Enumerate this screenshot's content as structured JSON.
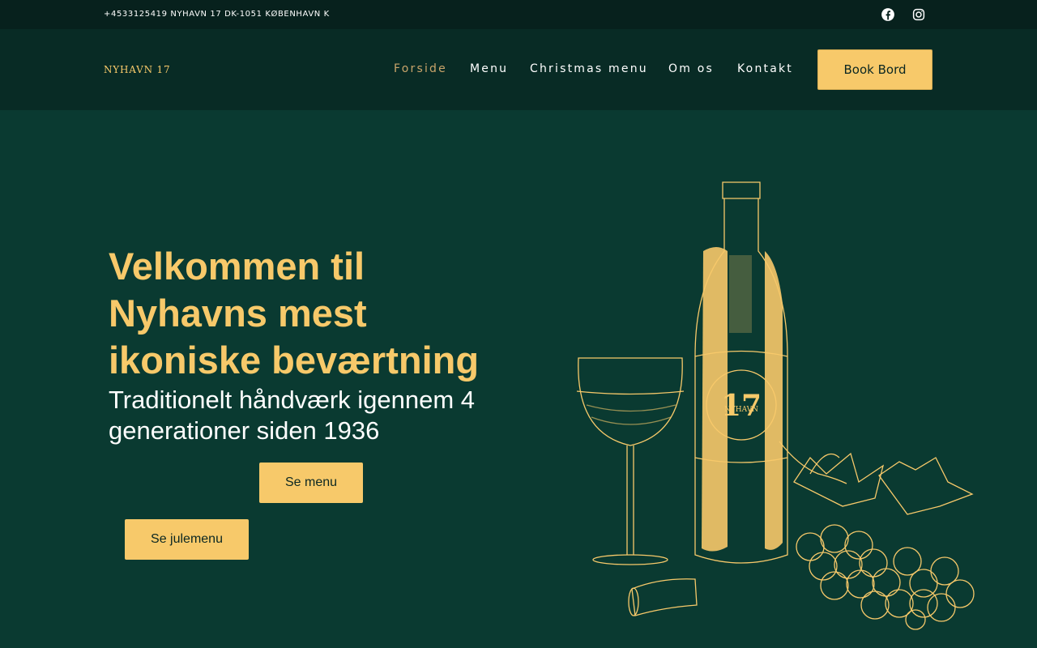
{
  "topbar": {
    "contact": "+4533125419 NYHAVN 17 DK-1051 KØBENHAVN K",
    "social": [
      {
        "name": "facebook-icon"
      },
      {
        "name": "instagram-icon"
      }
    ]
  },
  "header": {
    "logo": "NYHAVN 17",
    "nav": [
      {
        "label": "Forside",
        "active": true
      },
      {
        "label": "Menu"
      },
      {
        "label": "Christmas menu"
      },
      {
        "label": "Om os"
      },
      {
        "label": "Kontakt"
      }
    ],
    "book_label": "Book Bord"
  },
  "hero": {
    "title": "Velkommen til Nyhavns mest ikoniske beværtning",
    "subtitle": "Traditionelt håndværk igennem 4 generationer siden 1936",
    "menu_button": "Se menu",
    "christmas_button": "Se julemenu",
    "label_number": "17",
    "label_name": "NYHAVN"
  },
  "colors": {
    "background": "#0a3a31",
    "topbar": "#07211d",
    "navbar": "#082b25",
    "accent": "#f7c96a",
    "active_nav": "#c9a46a"
  }
}
